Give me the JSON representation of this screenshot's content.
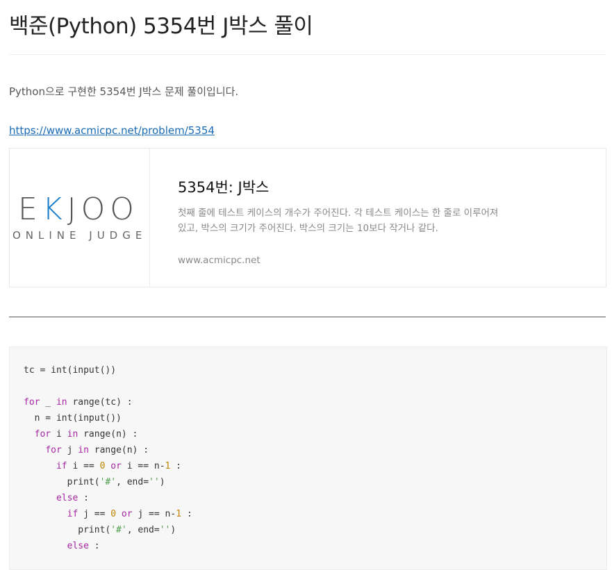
{
  "post": {
    "title": "백준(Python) 5354번 J박스 풀이",
    "intro": "Python으로 구현한 5354번 J박스 문제 풀이입니다.",
    "link_text": "https://www.acmicpc.net/problem/5354"
  },
  "link_card": {
    "logo_text_left": "E",
    "logo_text_k": "K",
    "logo_text_right": "JOO",
    "logo_subtext": "ONLINE JUDGE",
    "title": "5354번: J박스",
    "description": "첫째 줄에 테스트 케이스의 개수가 주어진다. 각 테스트 케이스는 한 줄로 이루어져 있고, 박스의 크기가 주어진다. 박스의 크기는 10보다 작거나 같다.",
    "domain": "www.acmicpc.net"
  },
  "code": {
    "lines": [
      [
        {
          "t": "tc = int(input())",
          "c": ""
        }
      ],
      [],
      [
        {
          "t": "for",
          "c": "kw"
        },
        {
          "t": " _ ",
          "c": ""
        },
        {
          "t": "in",
          "c": "kw"
        },
        {
          "t": " range(tc) :",
          "c": ""
        }
      ],
      [
        {
          "t": "  n = int(input())",
          "c": ""
        }
      ],
      [
        {
          "t": "  ",
          "c": ""
        },
        {
          "t": "for",
          "c": "kw"
        },
        {
          "t": " i ",
          "c": ""
        },
        {
          "t": "in",
          "c": "kw"
        },
        {
          "t": " range(n) :",
          "c": ""
        }
      ],
      [
        {
          "t": "    ",
          "c": ""
        },
        {
          "t": "for",
          "c": "kw"
        },
        {
          "t": " j ",
          "c": ""
        },
        {
          "t": "in",
          "c": "kw"
        },
        {
          "t": " range(n) :",
          "c": ""
        }
      ],
      [
        {
          "t": "      ",
          "c": ""
        },
        {
          "t": "if",
          "c": "kw"
        },
        {
          "t": " i == ",
          "c": ""
        },
        {
          "t": "0",
          "c": "num"
        },
        {
          "t": " ",
          "c": ""
        },
        {
          "t": "or",
          "c": "kw"
        },
        {
          "t": " i == n-",
          "c": ""
        },
        {
          "t": "1",
          "c": "num"
        },
        {
          "t": " :",
          "c": ""
        }
      ],
      [
        {
          "t": "        print(",
          "c": ""
        },
        {
          "t": "'#'",
          "c": "str"
        },
        {
          "t": ", end=",
          "c": ""
        },
        {
          "t": "''",
          "c": "str"
        },
        {
          "t": ")",
          "c": ""
        }
      ],
      [
        {
          "t": "      ",
          "c": ""
        },
        {
          "t": "else",
          "c": "kw"
        },
        {
          "t": " :",
          "c": ""
        }
      ],
      [
        {
          "t": "        ",
          "c": ""
        },
        {
          "t": "if",
          "c": "kw"
        },
        {
          "t": " j == ",
          "c": ""
        },
        {
          "t": "0",
          "c": "num"
        },
        {
          "t": " ",
          "c": ""
        },
        {
          "t": "or",
          "c": "kw"
        },
        {
          "t": " j == n-",
          "c": ""
        },
        {
          "t": "1",
          "c": "num"
        },
        {
          "t": " :",
          "c": ""
        }
      ],
      [
        {
          "t": "          print(",
          "c": ""
        },
        {
          "t": "'#'",
          "c": "str"
        },
        {
          "t": ", end=",
          "c": ""
        },
        {
          "t": "''",
          "c": "str"
        },
        {
          "t": ")",
          "c": ""
        }
      ],
      [
        {
          "t": "        ",
          "c": ""
        },
        {
          "t": "else",
          "c": "kw"
        },
        {
          "t": " :",
          "c": ""
        }
      ]
    ]
  },
  "colors": {
    "link": "#1a6bb5",
    "keyword": "#a626a4",
    "number": "#c18401",
    "string": "#50a14f",
    "logo_accent": "#1f7fc9",
    "code_background": "#f7f7f7"
  }
}
